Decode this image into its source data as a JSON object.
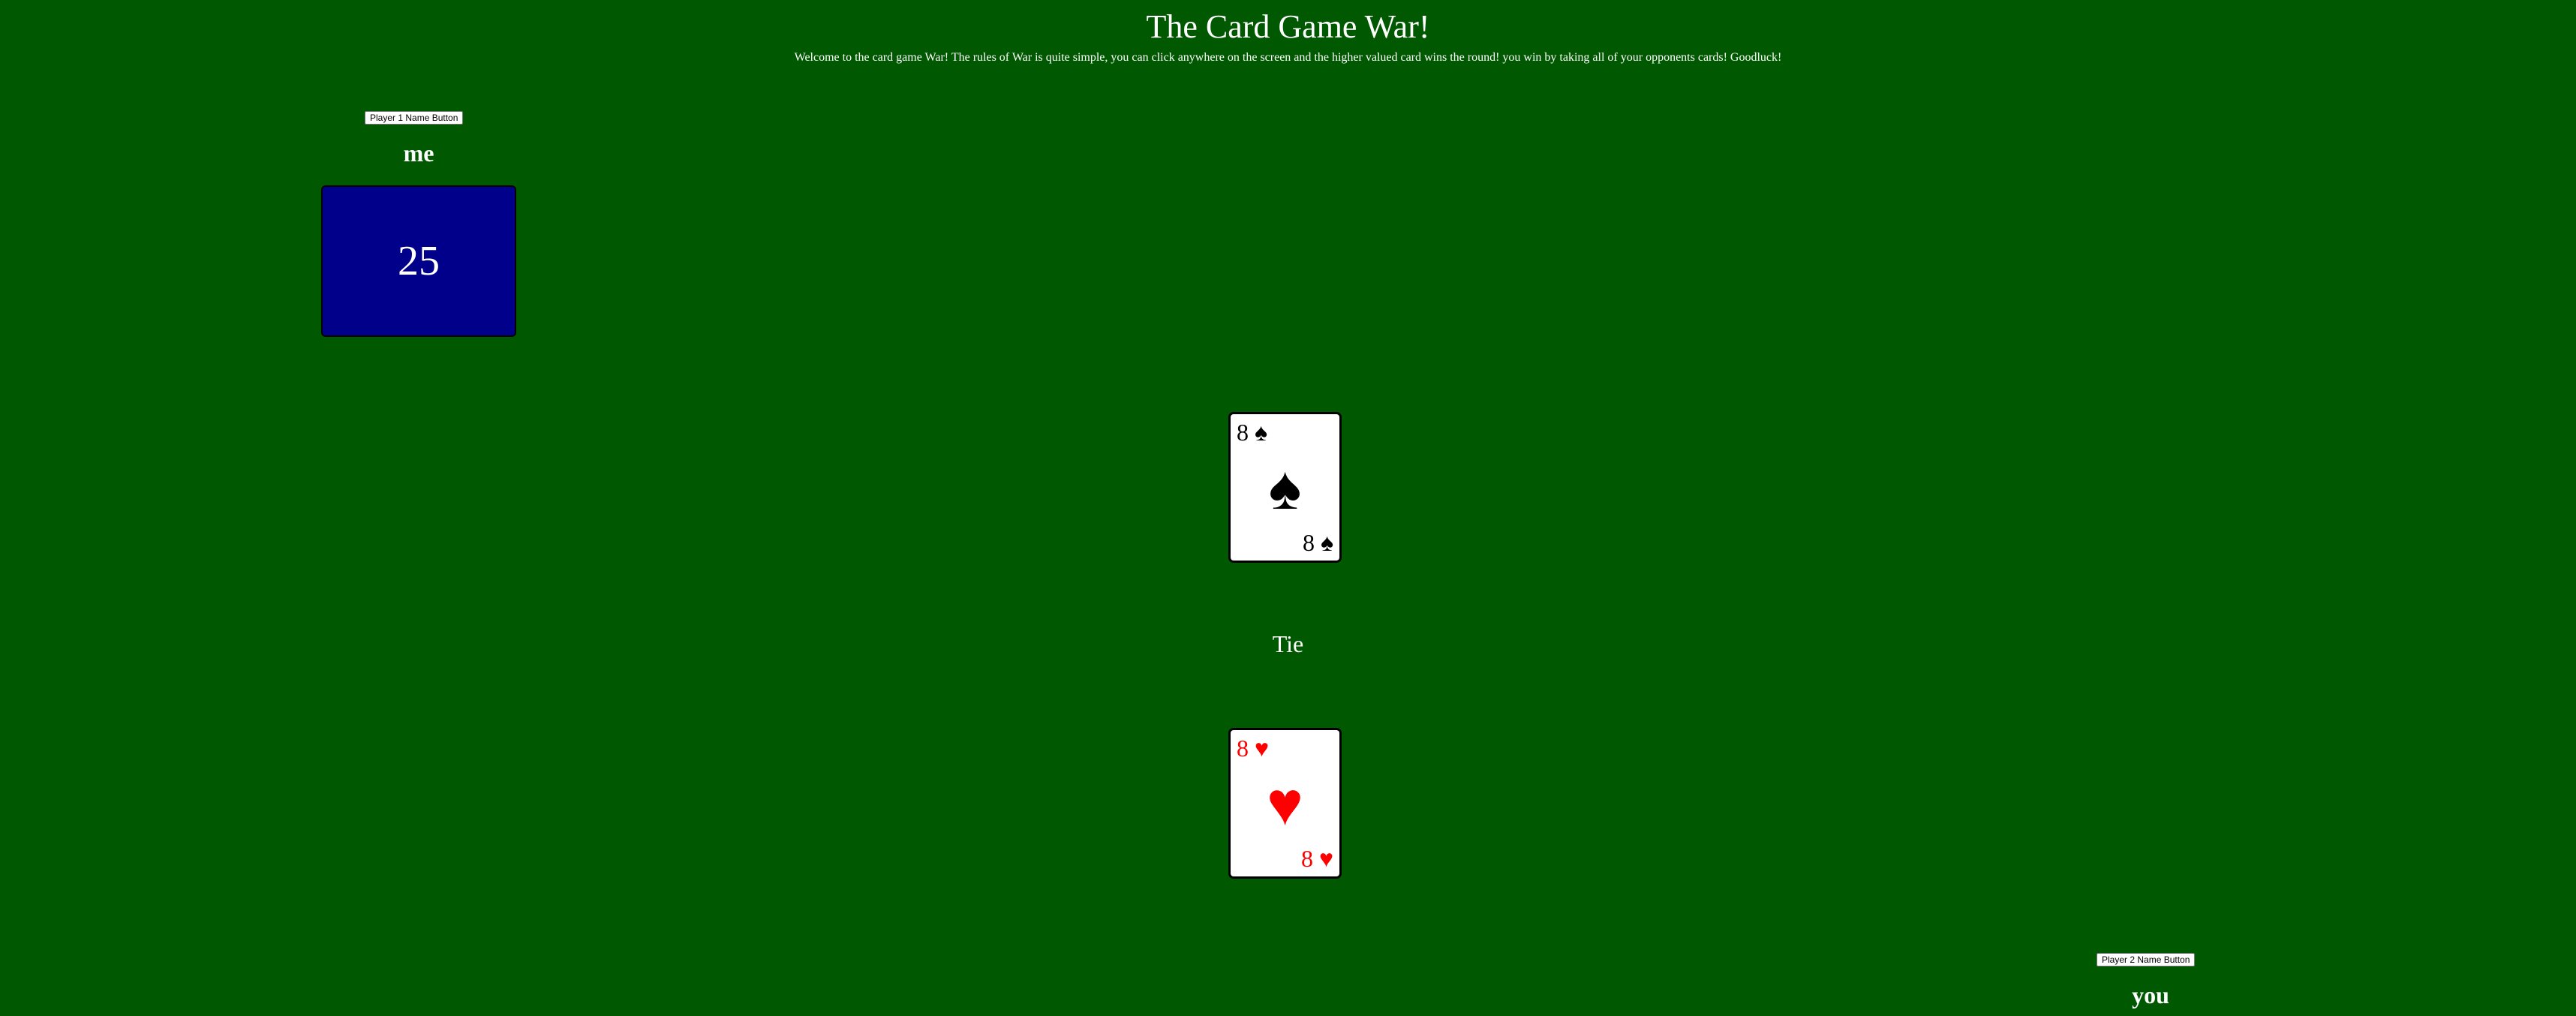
{
  "header": {
    "title": "The Card Game War!",
    "intro": "Welcome to the card game War! The rules of War is quite simple, you can click anywhere on the screen and the higher valued card wins the round! you win by taking all of your opponents cards! Goodluck!"
  },
  "player1": {
    "button_label": "Player 1 Name Button",
    "name": "me",
    "deck_count": "25",
    "deck_color": "#00008b"
  },
  "player2": {
    "button_label": "Player 2 Name Button",
    "name": "you"
  },
  "table": {
    "top_card": {
      "rank": "8",
      "suit": "♠",
      "suit_name": "spades",
      "color": "#000000"
    },
    "bottom_card": {
      "rank": "8",
      "suit": "♥",
      "suit_name": "hearts",
      "color": "#ff0000"
    },
    "result": "Tie"
  },
  "colors": {
    "background": "#005800",
    "text": "#ffffff"
  }
}
